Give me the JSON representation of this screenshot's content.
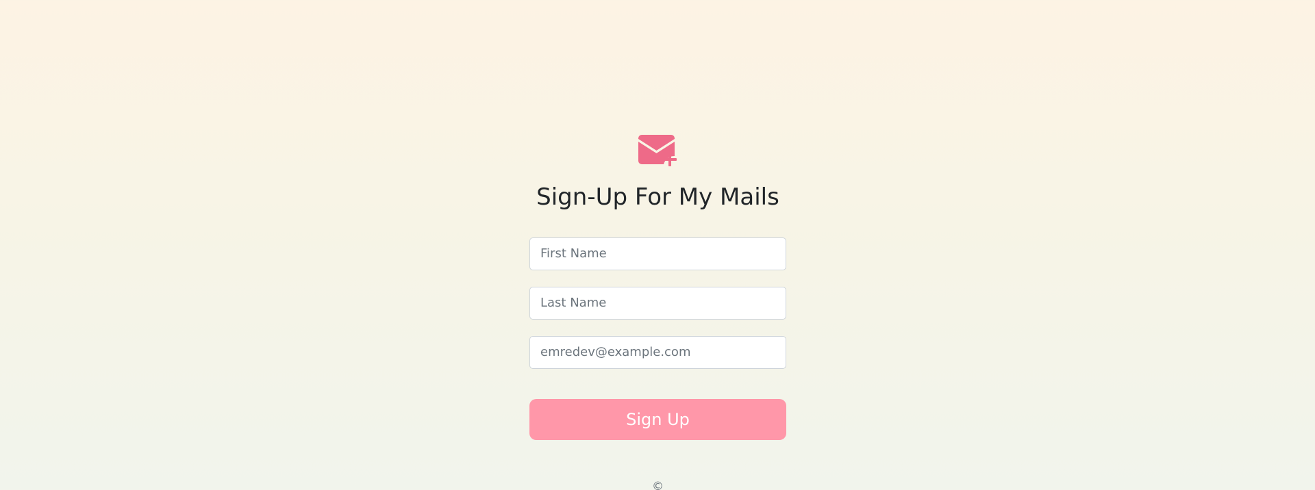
{
  "form": {
    "title": "Sign-Up For My Mails",
    "icon": "envelope-plus-icon",
    "first_name_placeholder": "First Name",
    "last_name_placeholder": "Last Name",
    "email_placeholder": "emredev@example.com",
    "submit_label": "Sign Up"
  },
  "footer": {
    "text": "©"
  },
  "colors": {
    "accent": "#ee6a88",
    "button": "#ff97a9"
  }
}
